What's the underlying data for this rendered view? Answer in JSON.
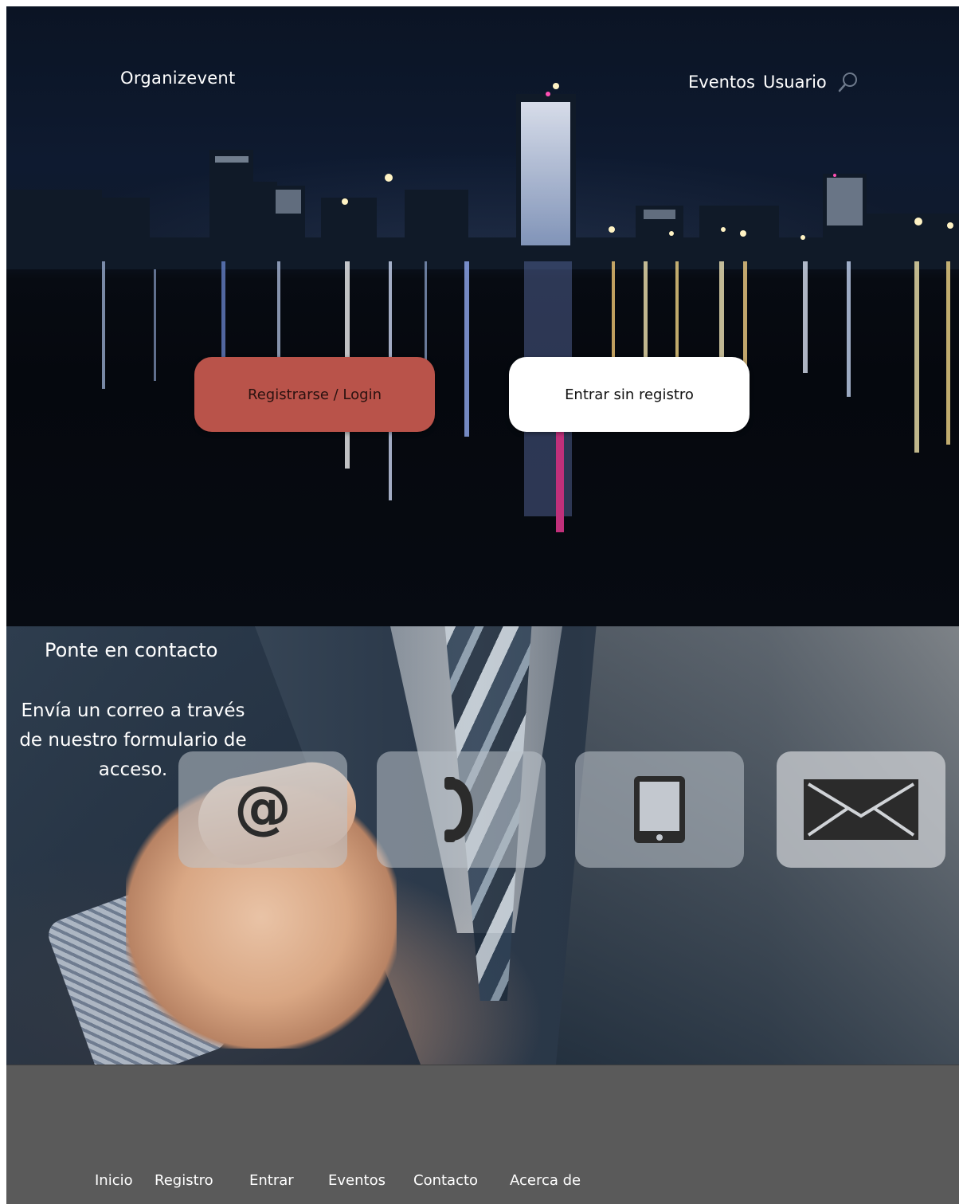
{
  "header": {
    "brand": "Organizevent",
    "nav": [
      "Eventos",
      "Usuario"
    ],
    "search_icon": "search-icon"
  },
  "hero": {
    "register_label": "Registrarse / Login",
    "guest_label": "Entrar sin registro",
    "register_color": "#b9534a",
    "guest_color": "#ffffff"
  },
  "contact": {
    "title": "Ponte en contacto",
    "description": "Envía un correo a través de nuestro formulario de acceso.",
    "tiles": [
      {
        "icon": "at-sign-icon"
      },
      {
        "icon": "phone-icon"
      },
      {
        "icon": "tablet-icon"
      },
      {
        "icon": "envelope-icon"
      }
    ]
  },
  "footer": {
    "nav": [
      "Inicio",
      "Registro",
      "Entrar",
      "Eventos",
      "Contacto",
      "Acerca de"
    ]
  }
}
